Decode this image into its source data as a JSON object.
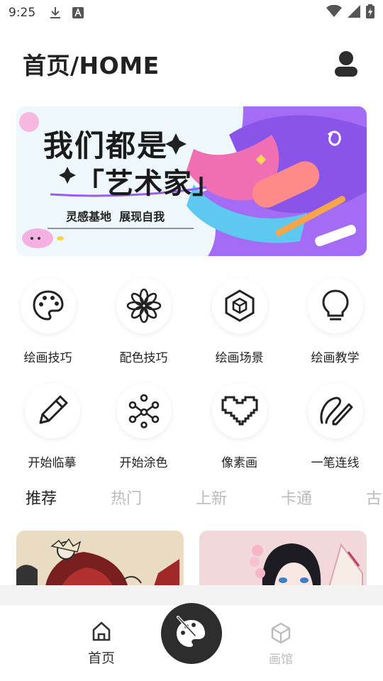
{
  "status_bar": {
    "time": "9:25"
  },
  "header": {
    "title": "首页/HOME"
  },
  "banner": {
    "line1": "我们都是",
    "line2": "「艺术家」",
    "slogan": "灵感基地  展现自我"
  },
  "features": [
    {
      "label": "绘画技巧",
      "icon": "palette-icon"
    },
    {
      "label": "配色技巧",
      "icon": "flower-icon"
    },
    {
      "label": "绘画场景",
      "icon": "cube-icon"
    },
    {
      "label": "绘画教学",
      "icon": "lightbulb-icon"
    },
    {
      "label": "开始临摹",
      "icon": "pencil-icon"
    },
    {
      "label": "开始涂色",
      "icon": "molecule-icon"
    },
    {
      "label": "像素画",
      "icon": "pixel-heart-icon"
    },
    {
      "label": "一笔连线",
      "icon": "pen-stroke-icon"
    }
  ],
  "tabs": [
    "推荐",
    "热门",
    "上新",
    "卡通",
    "古"
  ],
  "bottom_nav": {
    "home": "首页",
    "gallery": "画馆"
  },
  "colors": {
    "accent": "#2d2d2d",
    "inactive": "#bbbbbb",
    "banner_purple": "#9b5cf6"
  }
}
